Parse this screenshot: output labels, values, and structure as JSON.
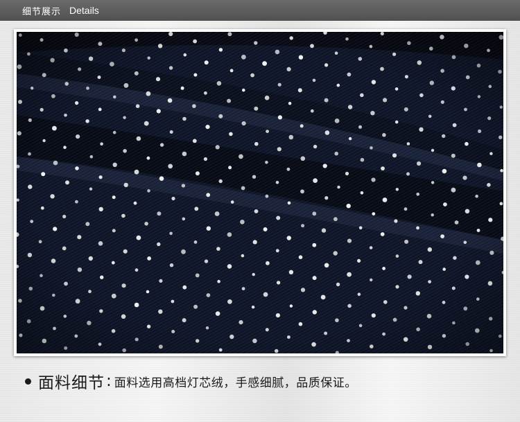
{
  "header": {
    "title_zh": "细节展示",
    "title_en": "Details"
  },
  "photo": {
    "subject": "fabric-closeup-image",
    "fabric_color": "#0e1528",
    "dot_color": "#f2f2f2"
  },
  "caption": {
    "title": "面料细节",
    "separator": ":",
    "text": "面料选用高档灯芯绒，手感细腻，品质保证。"
  },
  "colors": {
    "header_bg": "#5a5a5a",
    "page_bg": "#efefef",
    "text": "#1a1a1a"
  }
}
